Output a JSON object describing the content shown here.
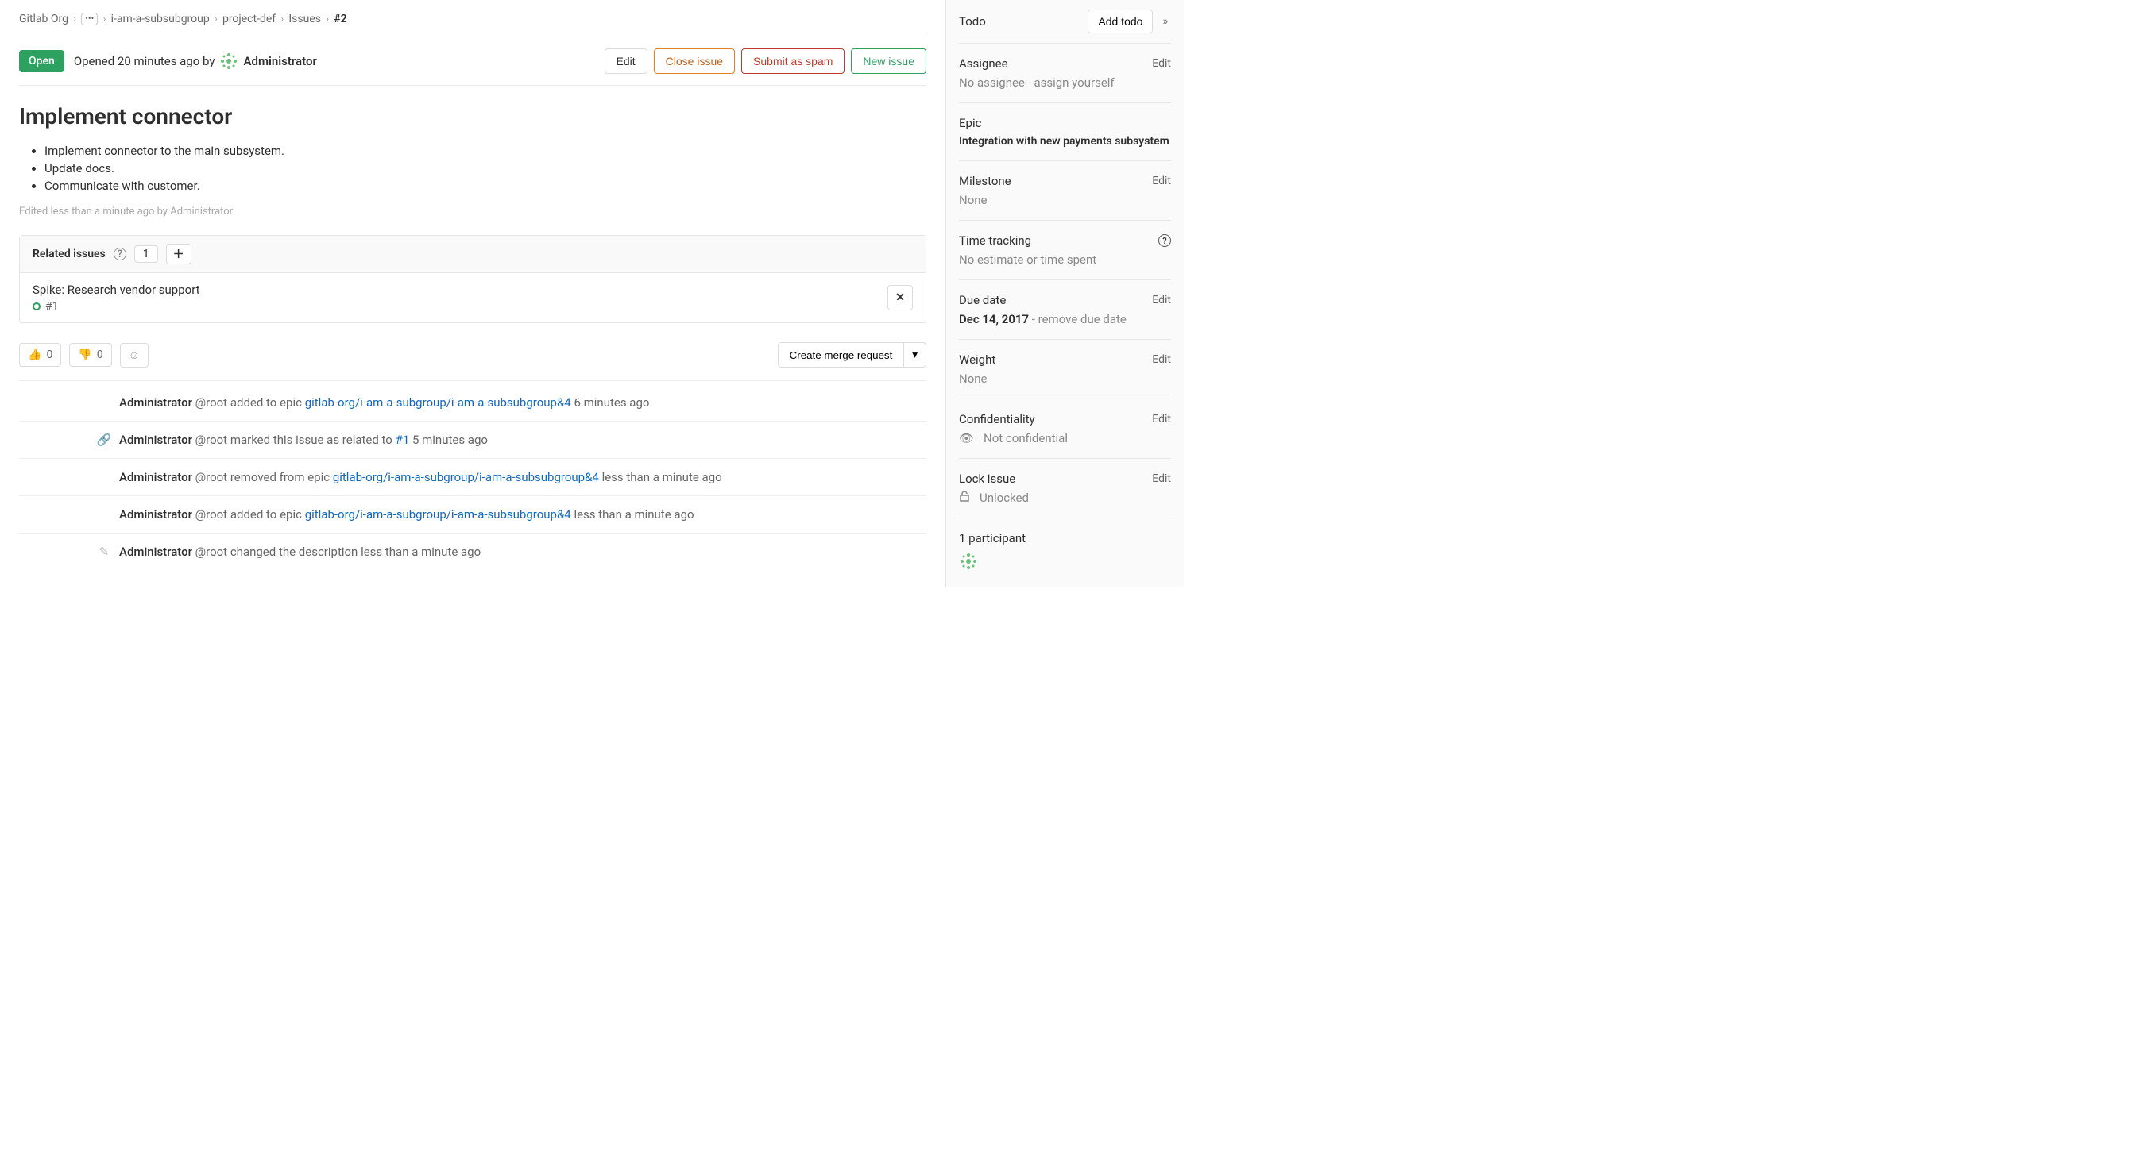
{
  "breadcrumbs": {
    "org": "Gitlab Org",
    "subgroup": "i-am-a-subsubgroup",
    "project": "project-def",
    "section": "Issues",
    "ref": "#2"
  },
  "status": {
    "badge": "Open",
    "opened_text": "Opened 20 minutes ago by",
    "author": "Administrator"
  },
  "actions": {
    "edit": "Edit",
    "close": "Close issue",
    "spam": "Submit as spam",
    "new": "New issue"
  },
  "issue": {
    "title": "Implement connector",
    "bullets": [
      "Implement connector to the main subsystem.",
      "Update docs.",
      "Communicate with customer."
    ],
    "edited_note": "Edited less than a minute ago by Administrator"
  },
  "related": {
    "label": "Related issues",
    "count": "1",
    "item_title": "Spike: Research vendor support",
    "item_ref": "#1"
  },
  "reactions": {
    "thumbs_up": "0",
    "thumbs_down": "0",
    "create_mr": "Create merge request"
  },
  "activity": [
    {
      "icon": "",
      "author": "Administrator",
      "handle": "@root",
      "action": " added to epic ",
      "link": "gitlab-org/i-am-a-subgroup/i-am-a-subsubgroup&4",
      "time": " 6 minutes ago"
    },
    {
      "icon": "link",
      "author": "Administrator",
      "handle": "@root",
      "action": " marked this issue as related to ",
      "link": "#1",
      "time": " 5 minutes ago"
    },
    {
      "icon": "",
      "author": "Administrator",
      "handle": "@root",
      "action": " removed from epic ",
      "link": "gitlab-org/i-am-a-subgroup/i-am-a-subsubgroup&4",
      "time": " less than a minute ago"
    },
    {
      "icon": "",
      "author": "Administrator",
      "handle": "@root",
      "action": " added to epic ",
      "link": "gitlab-org/i-am-a-subgroup/i-am-a-subsubgroup&4",
      "time": " less than a minute ago"
    },
    {
      "icon": "pencil",
      "author": "Administrator",
      "handle": "@root",
      "action": " changed the description ",
      "link": "",
      "time": "less than a minute ago"
    }
  ],
  "sidebar": {
    "todo_label": "Todo",
    "add_todo": "Add todo",
    "assignee_label": "Assignee",
    "assignee_value": "No assignee - ",
    "assign_yourself": "assign yourself",
    "epic_label": "Epic",
    "epic_value": "Integration with new payments subsystem",
    "milestone_label": "Milestone",
    "milestone_value": "None",
    "time_label": "Time tracking",
    "time_value": "No estimate or time spent",
    "due_label": "Due date",
    "due_value": "Dec 14, 2017",
    "due_remove": " - remove due date",
    "weight_label": "Weight",
    "weight_value": "None",
    "conf_label": "Confidentiality",
    "conf_value": "Not confidential",
    "lock_label": "Lock issue",
    "lock_value": "Unlocked",
    "participants": "1 participant",
    "edit": "Edit"
  }
}
